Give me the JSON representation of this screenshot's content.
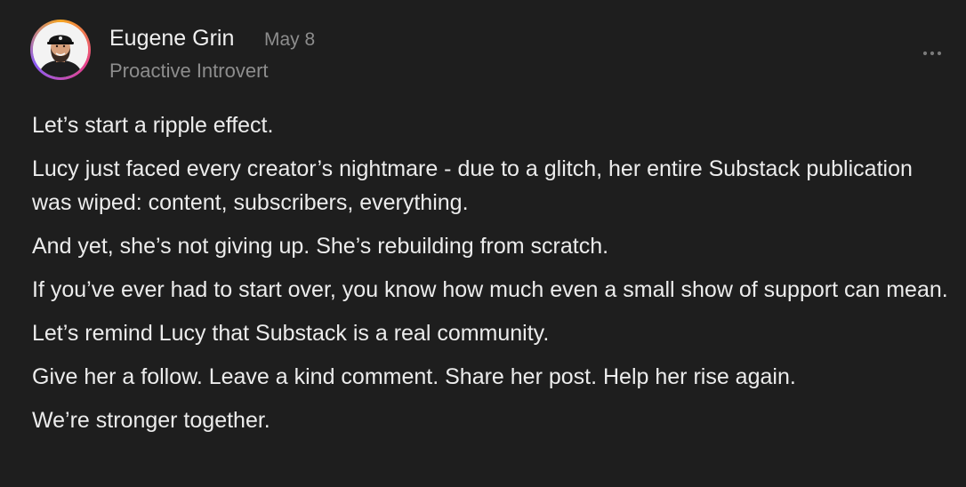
{
  "author": {
    "name": "Eugene Grin",
    "date": "May 8",
    "subtitle": "Proactive Introvert"
  },
  "icons": {
    "avatar": "profile-photo",
    "more": "ellipsis-icon"
  },
  "colors": {
    "background": "#1e1e1e",
    "text": "#ececec",
    "muted": "#8d8d8d"
  },
  "post": {
    "paragraphs": [
      "Let’s start a ripple effect.",
      "Lucy just faced every creator’s nightmare - due to a glitch, her entire Substack publication was wiped: content, subscribers, everything.",
      "And yet, she’s not giving up. She’s rebuilding from scratch.",
      "If you’ve ever had to start over, you know how much even a small show of support can mean.",
      "Let’s remind Lucy that Substack is a real community.",
      "Give her a follow. Leave a kind comment. Share her post. Help her rise again.",
      "We’re stronger together."
    ]
  }
}
